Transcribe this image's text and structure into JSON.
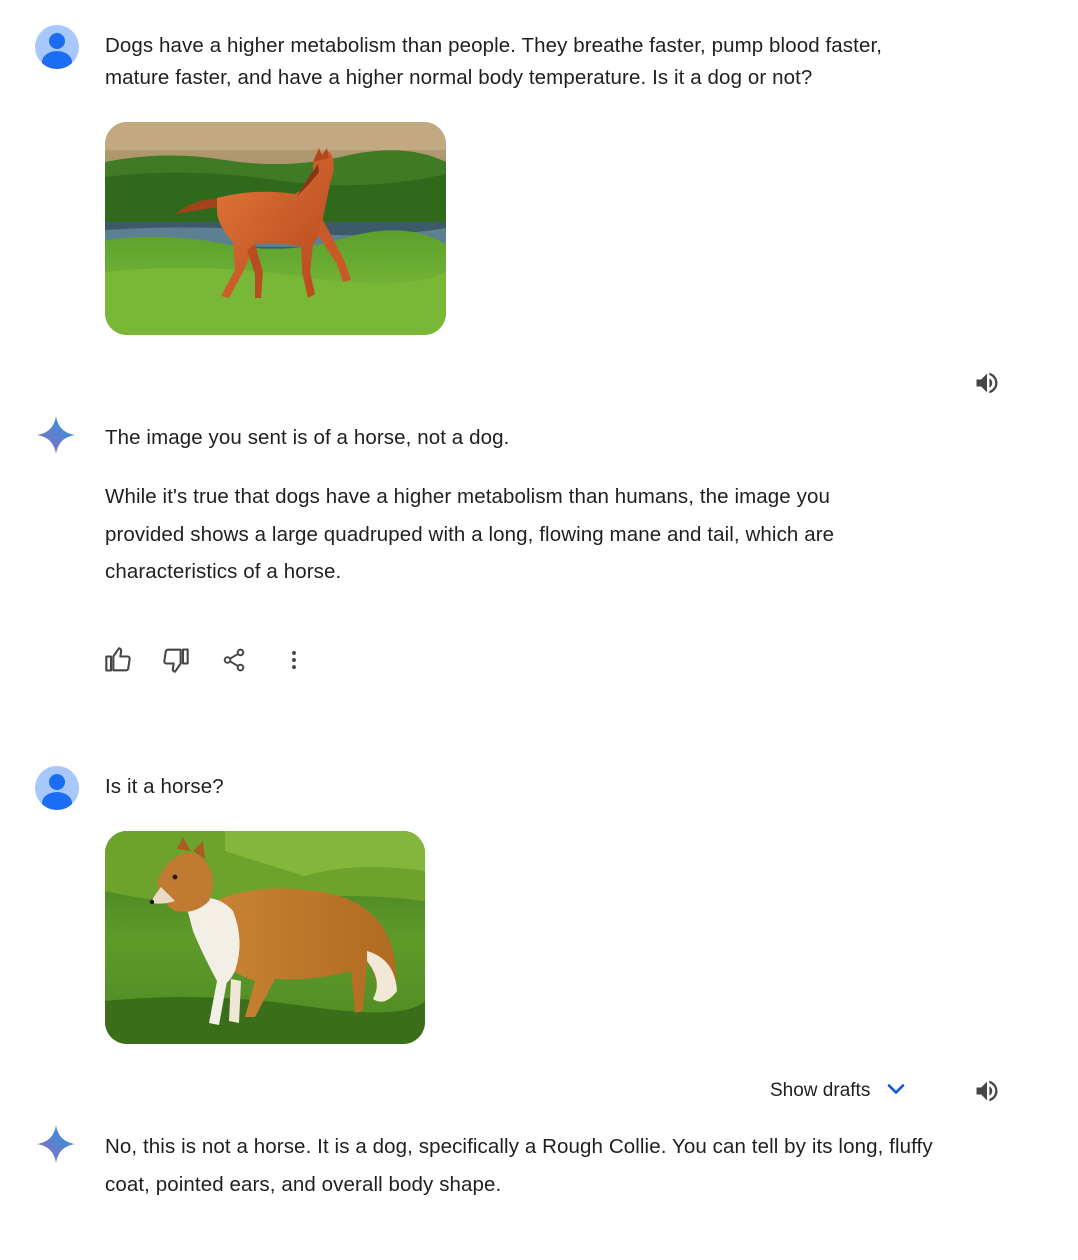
{
  "conversation": {
    "user_prompt_1": {
      "text": "Dogs have a higher metabolism than people. They breathe faster, pump blood faster, mature faster, and have a higher normal body temperature. Is it a dog or not?",
      "image_icon": "horse-photo"
    },
    "response_1": {
      "para1": "The image you sent is of a horse, not a dog.",
      "para2": "While it's true that dogs have a higher metabolism than humans, the image you provided shows a large quadruped with a long, flowing mane and tail, which are characteristics of a horse."
    },
    "user_prompt_2": {
      "text": "Is it a horse?",
      "image_icon": "collie-photo"
    },
    "response_2": {
      "show_drafts_label": "Show drafts",
      "text": "No, this is not a horse. It is a dog, specifically a Rough Collie. You can tell by its long, fluffy coat, pointed ears, and overall body shape."
    }
  },
  "icons": {
    "speaker": "volume-icon",
    "thumbs_up": "thumb-up-icon",
    "thumbs_down": "thumb-down-icon",
    "share": "share-icon",
    "more": "more-vert-icon",
    "chevron": "chevron-down-icon",
    "spark": "gemini-spark-icon",
    "avatar": "user-avatar-icon"
  },
  "colors": {
    "avatar_bg": "#a8c7fa",
    "avatar_fg": "#1b6ef3",
    "accent_blue": "#0b57d0",
    "text": "#1f1f1f",
    "icon": "#444746"
  }
}
